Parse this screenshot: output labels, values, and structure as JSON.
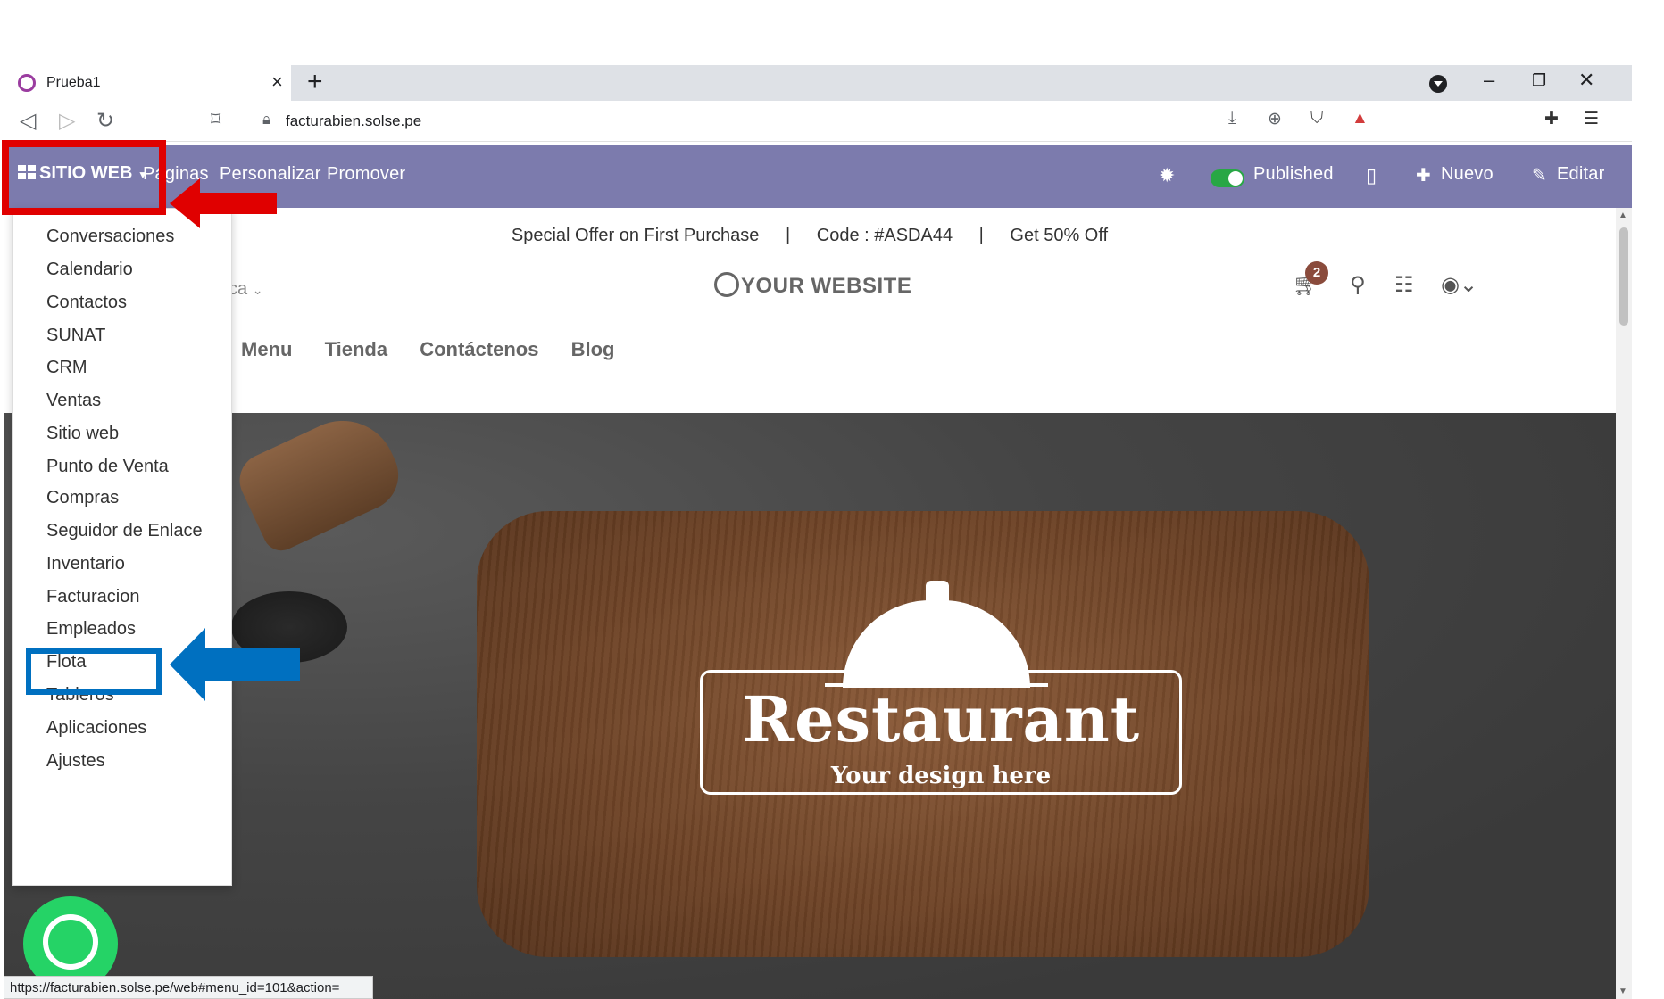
{
  "browser": {
    "tab_title": "Prueba1",
    "tab_close": "×",
    "new_tab": "+",
    "url": "facturabien.solse.pe",
    "window_minimize": "–",
    "window_restore": "❐",
    "window_close": "✕",
    "status_url": "https://facturabien.solse.pe/web#menu_id=101&action="
  },
  "odoo_bar": {
    "apps_label": "SITIO WEB",
    "menu": [
      "Páginas",
      "Personalizar",
      "Promover"
    ],
    "published_label": "Published",
    "new_label": "Nuevo",
    "edit_label": "Editar",
    "accent_color": "#7c7bad"
  },
  "app_menu": {
    "items": [
      "Conversaciones",
      "Calendario",
      "Contactos",
      "SUNAT",
      "CRM",
      "Ventas",
      "Sitio web",
      "Punto de Venta",
      "Compras",
      "Seguidor de Enlace",
      "Inventario",
      "Facturacion",
      "Empleados",
      "Flota",
      "Tableros",
      "Aplicaciones",
      "Ajustes"
    ],
    "highlighted_item": "Facturacion"
  },
  "website": {
    "promo": [
      "Special Offer on First Purchase",
      "|",
      "Code : #ASDA44",
      "|",
      "Get 50% Off"
    ],
    "logo_text": "YOUR WEBSITE",
    "lang_fragment": "ca",
    "cart_count": "2",
    "nav": [
      "Menu",
      "Tienda",
      "Contáctenos",
      "Blog"
    ],
    "hero_title": "Restaurant",
    "hero_subtitle": "Your design here"
  },
  "annotations": {
    "red_color": "#e00000",
    "blue_color": "#0070c0"
  }
}
